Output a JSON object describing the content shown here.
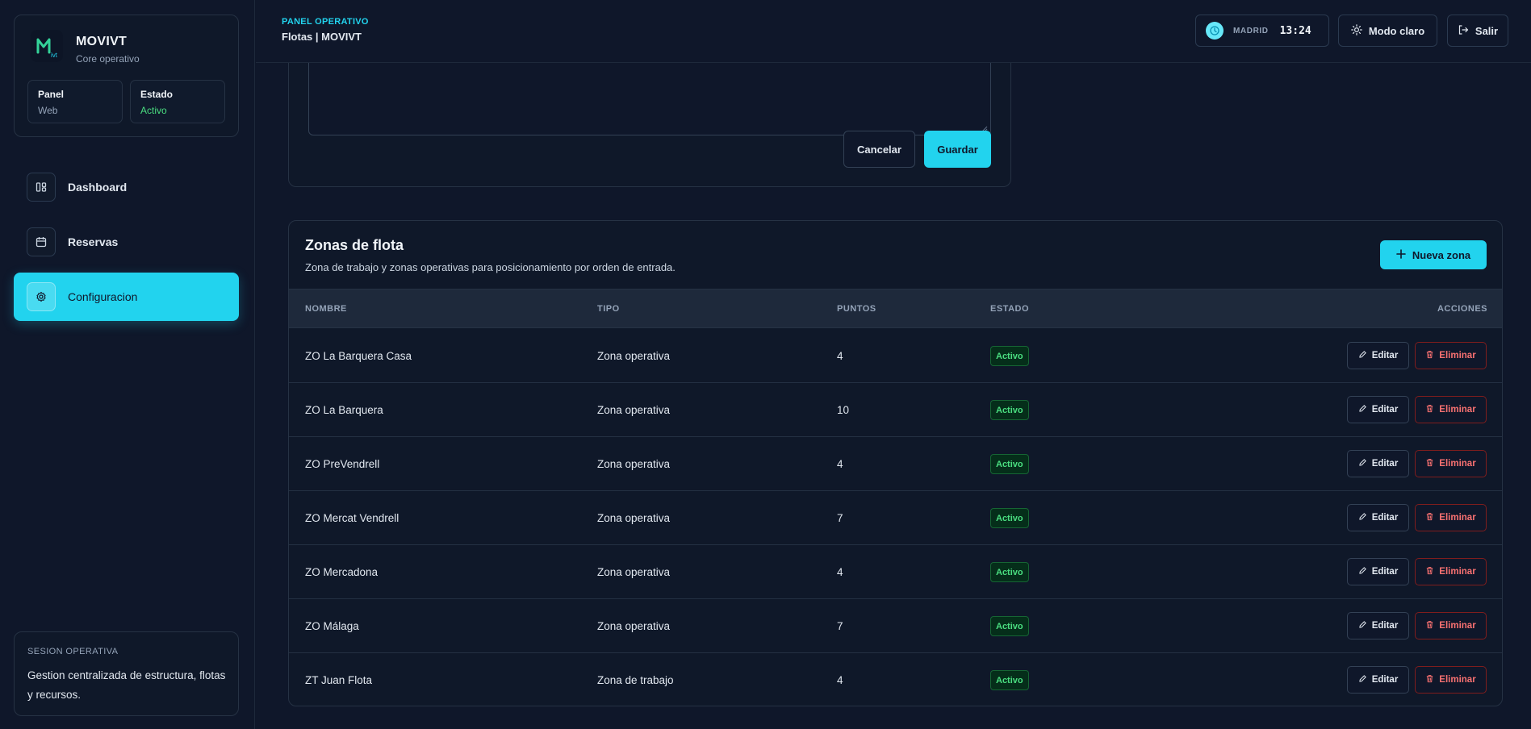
{
  "brand": {
    "title": "MOVIVT",
    "subtitle": "Core operativo",
    "panel_label": "Panel",
    "panel_value": "Web",
    "estado_label": "Estado",
    "estado_value": "Activo",
    "accent": "#22d3ee"
  },
  "sidebar": {
    "items": [
      {
        "label": "Dashboard",
        "icon": "layout-columns-icon"
      },
      {
        "label": "Reservas",
        "icon": "calendar-icon"
      },
      {
        "label": "Configuracion",
        "icon": "gear-icon",
        "active": true
      }
    ],
    "session": {
      "title": "SESION OPERATIVA",
      "description": "Gestion centralizada de estructura, flotas y recursos."
    }
  },
  "topbar": {
    "overline": "PANEL OPERATIVO",
    "title": "Flotas | MOVIVT",
    "clock_city": "MADRID",
    "clock_time": "13:24",
    "theme_label": "Modo claro",
    "logout_label": "Salir"
  },
  "form": {
    "cancel_label": "Cancelar",
    "save_label": "Guardar"
  },
  "zones": {
    "title": "Zonas de flota",
    "subtitle": "Zona de trabajo y zonas operativas para posicionamiento por orden de entrada.",
    "new_label": "Nueva zona",
    "columns": {
      "nombre": "NOMBRE",
      "tipo": "TIPO",
      "puntos": "PUNTOS",
      "estado": "ESTADO",
      "acciones": "ACCIONES"
    },
    "edit_label": "Editar",
    "delete_label": "Eliminar",
    "rows": [
      {
        "nombre": "ZO La Barquera Casa",
        "tipo": "Zona operativa",
        "puntos": "4",
        "estado": "Activo"
      },
      {
        "nombre": "ZO La Barquera",
        "tipo": "Zona operativa",
        "puntos": "10",
        "estado": "Activo"
      },
      {
        "nombre": "ZO PreVendrell",
        "tipo": "Zona operativa",
        "puntos": "4",
        "estado": "Activo"
      },
      {
        "nombre": "ZO Mercat Vendrell",
        "tipo": "Zona operativa",
        "puntos": "7",
        "estado": "Activo"
      },
      {
        "nombre": "ZO Mercadona",
        "tipo": "Zona operativa",
        "puntos": "4",
        "estado": "Activo"
      },
      {
        "nombre": "ZO Málaga",
        "tipo": "Zona operativa",
        "puntos": "7",
        "estado": "Activo"
      },
      {
        "nombre": "ZT Juan Flota",
        "tipo": "Zona de trabajo",
        "puntos": "4",
        "estado": "Activo"
      }
    ]
  }
}
